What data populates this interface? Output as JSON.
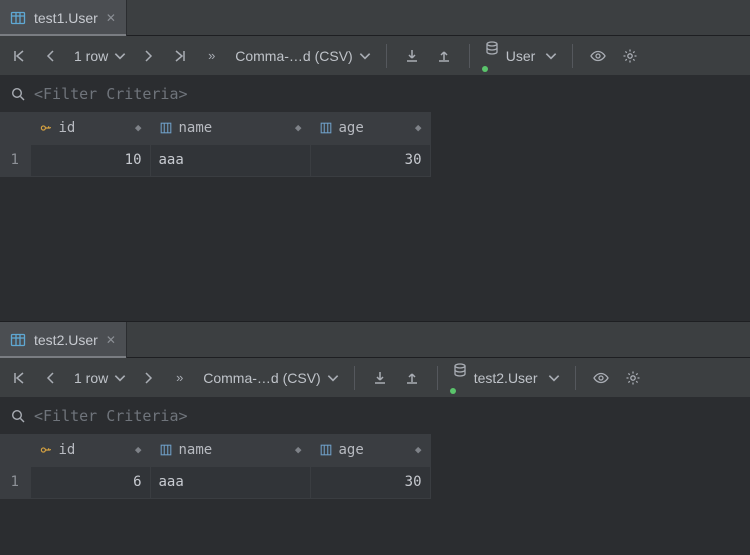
{
  "panes": [
    {
      "tab": "test1.User",
      "rowCount": "1 row",
      "format": "Comma-…d (CSV)",
      "dbLabel": "User",
      "filterPlaceholder": "<Filter Criteria>",
      "columns": [
        "id",
        "name",
        "age"
      ],
      "rows": [
        {
          "n": "1",
          "id": "10",
          "name": "aaa",
          "age": "30"
        }
      ]
    },
    {
      "tab": "test2.User",
      "rowCount": "1 row",
      "format": "Comma-…d (CSV)",
      "dbLabel": "test2.User",
      "filterPlaceholder": "<Filter Criteria>",
      "columns": [
        "id",
        "name",
        "age"
      ],
      "rows": [
        {
          "n": "1",
          "id": "6",
          "name": "aaa",
          "age": "30"
        }
      ]
    }
  ]
}
